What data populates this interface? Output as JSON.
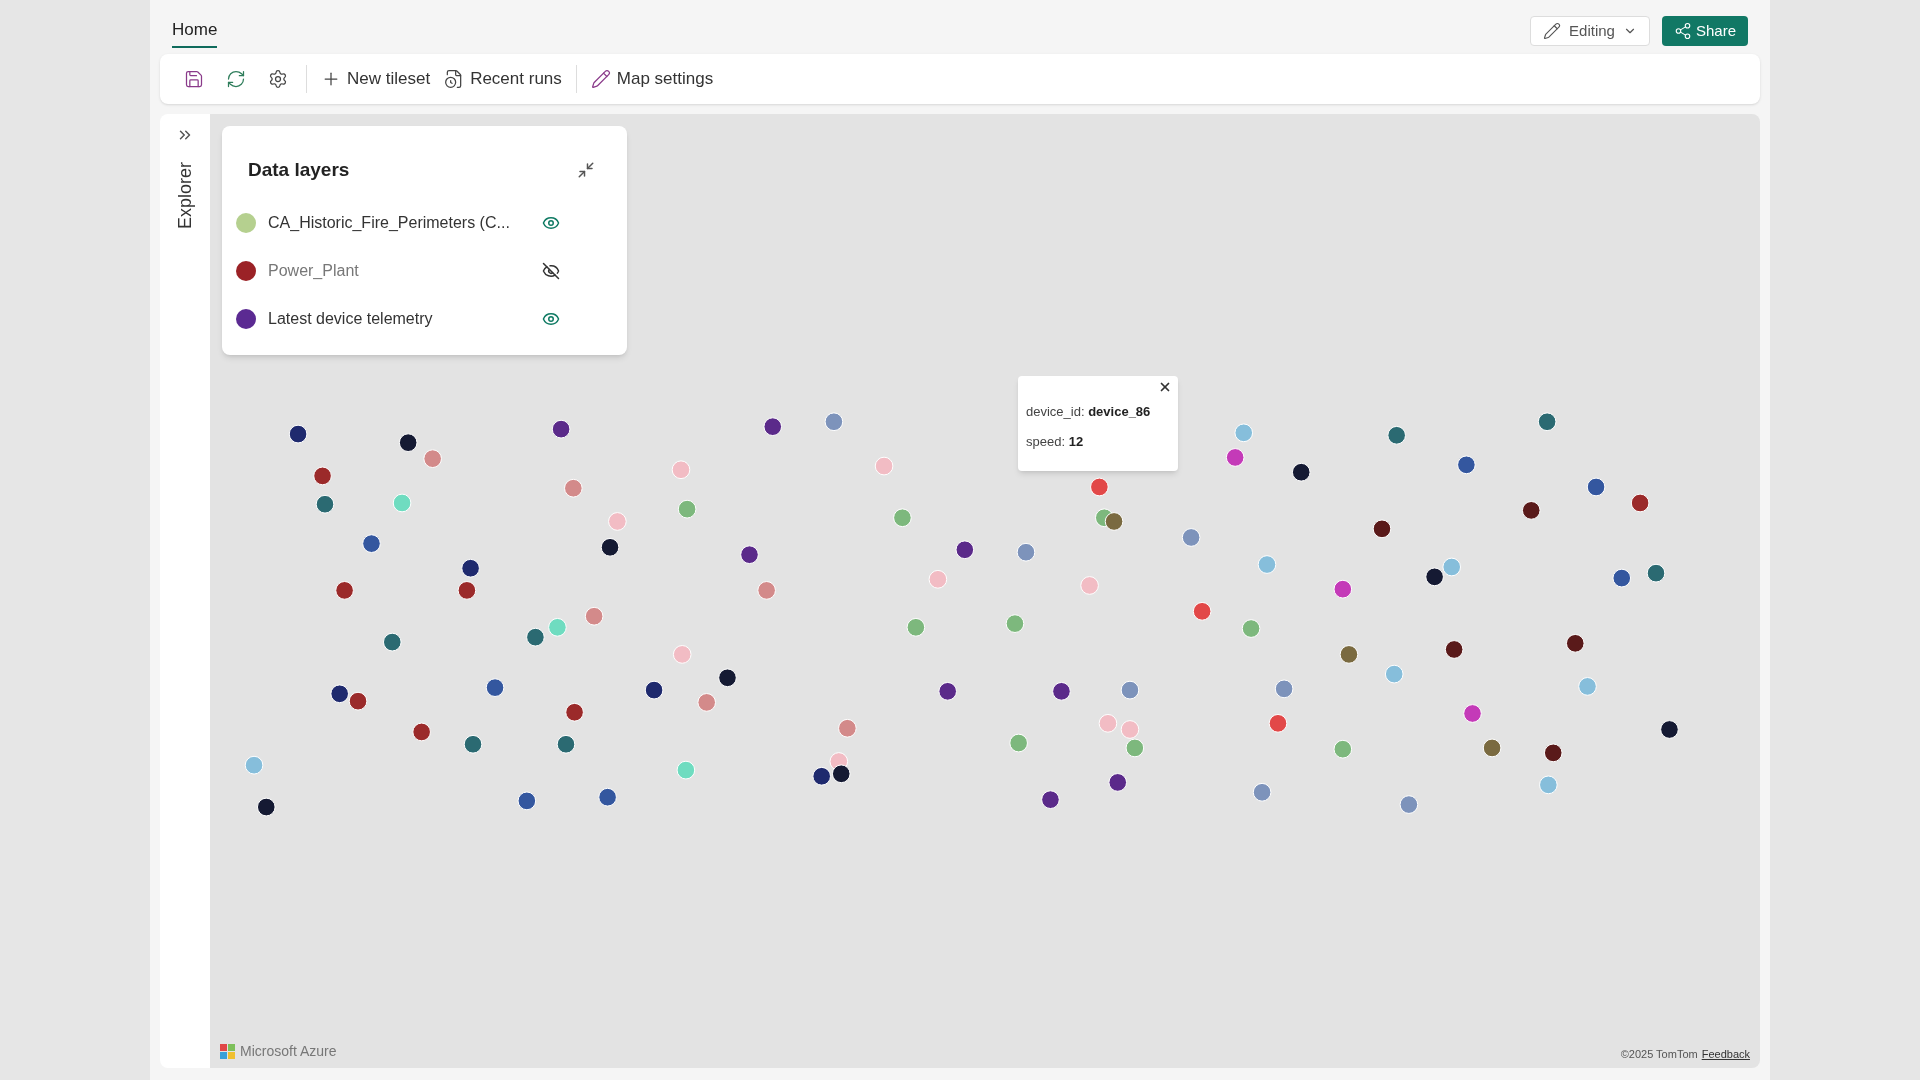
{
  "tabs": [
    {
      "label": "Home",
      "selected": true
    }
  ],
  "header_actions": {
    "mode": "Editing",
    "share": "Share"
  },
  "toolbar": {
    "items": [
      {
        "kind": "icon"
      },
      {
        "kind": "icon"
      },
      {
        "kind": "icon"
      },
      {
        "kind": "divider"
      },
      {
        "kind": "text",
        "label": "New tileset"
      },
      {
        "kind": "text",
        "label": "Recent runs"
      },
      {
        "kind": "divider"
      },
      {
        "kind": "text",
        "label": "Map settings"
      }
    ]
  },
  "sidebar": {
    "title": "Explorer"
  },
  "data_layers": {
    "title": "Data layers",
    "layers": [
      {
        "name": "CA_Historic_Fire_Perimeters (C...",
        "color": "#b5d08f",
        "visible": true
      },
      {
        "name": "Power_Plant",
        "color": "#9b2226",
        "visible": false
      },
      {
        "name": "Latest device telemetry",
        "color": "#5b2a92",
        "visible": true
      }
    ]
  },
  "popup": {
    "fields": [
      {
        "key": "device_id: ",
        "value": "device_86"
      },
      {
        "key": "speed: ",
        "value": "12"
      }
    ]
  },
  "attribution": {
    "brand": "Microsoft Azure",
    "copyright": "©2025 TomTom",
    "feedback": "Feedback"
  }
}
